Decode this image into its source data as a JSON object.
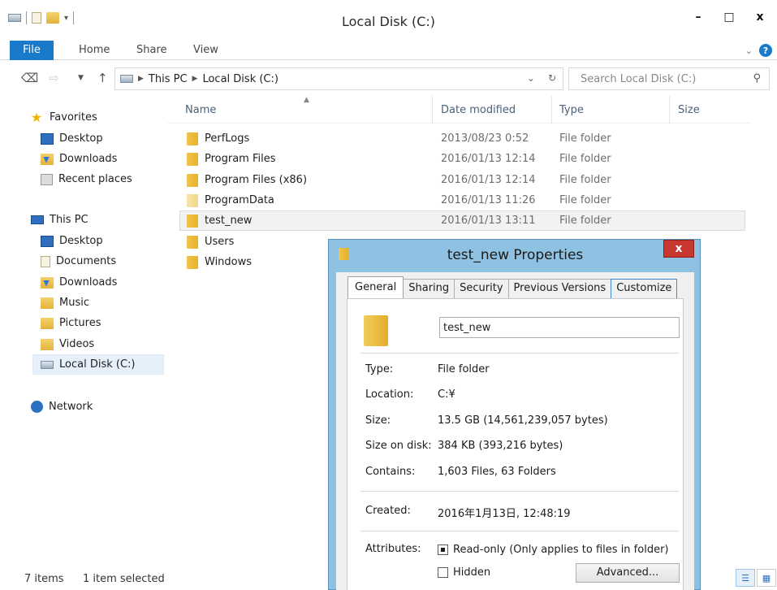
{
  "window": {
    "title": "Local Disk (C:)",
    "minimize": "–",
    "maximize": "□",
    "close": "x"
  },
  "ribbon": {
    "tabs": [
      "File",
      "Home",
      "Share",
      "View"
    ]
  },
  "address": {
    "crumbs": [
      "This PC",
      "Local Disk (C:)"
    ],
    "search_placeholder": "Search Local Disk (C:)"
  },
  "nav": {
    "favorites": "Favorites",
    "fav_items": [
      "Desktop",
      "Downloads",
      "Recent places"
    ],
    "thispc": "This PC",
    "pc_items": [
      "Desktop",
      "Documents",
      "Downloads",
      "Music",
      "Pictures",
      "Videos",
      "Local Disk (C:)"
    ],
    "network": "Network"
  },
  "list": {
    "headers": {
      "name": "Name",
      "date": "Date modified",
      "type": "Type",
      "size": "Size"
    },
    "rows": [
      {
        "name": "PerfLogs",
        "date": "2013/08/23 0:52",
        "type": "File folder"
      },
      {
        "name": "Program Files",
        "date": "2016/01/13 12:14",
        "type": "File folder"
      },
      {
        "name": "Program Files (x86)",
        "date": "2016/01/13 12:14",
        "type": "File folder"
      },
      {
        "name": "ProgramData",
        "date": "2016/01/13 11:26",
        "type": "File folder"
      },
      {
        "name": "test_new",
        "date": "2016/01/13 13:11",
        "type": "File folder"
      },
      {
        "name": "Users",
        "date": "",
        "type": ""
      },
      {
        "name": "Windows",
        "date": "",
        "type": ""
      }
    ]
  },
  "status": {
    "items": "7 items",
    "selected": "1 item selected"
  },
  "dialog": {
    "title": "test_new Properties",
    "tabs": [
      "General",
      "Sharing",
      "Security",
      "Previous Versions",
      "Customize"
    ],
    "folder_name": "test_new",
    "props": {
      "type_label": "Type:",
      "type_value": "File folder",
      "location_label": "Location:",
      "location_value": "C:¥",
      "size_label": "Size:",
      "size_value": "13.5 GB (14,561,239,057 bytes)",
      "disk_label": "Size on disk:",
      "disk_value": "384 KB (393,216 bytes)",
      "contains_label": "Contains:",
      "contains_value": "1,603 Files, 63 Folders",
      "created_label": "Created:",
      "created_value": "2016年1月13日, 12:48:19",
      "attributes_label": "Attributes:",
      "readonly_label": "Read-only (Only applies to files in folder)",
      "hidden_label": "Hidden",
      "advanced_label": "Advanced..."
    }
  }
}
